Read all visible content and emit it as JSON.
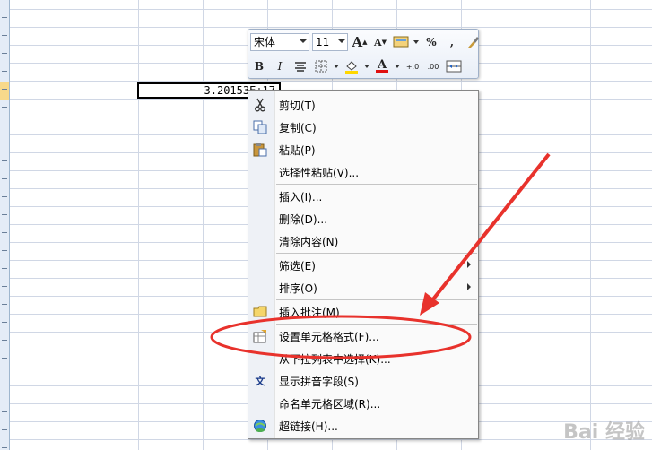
{
  "cell": {
    "value": "3.20153E+17"
  },
  "mini_toolbar": {
    "font_name": "宋体",
    "font_size": "11",
    "row1_icons": [
      "grow-font-icon",
      "shrink-font-icon",
      "format-painter-icon",
      "percent-icon",
      "comma-icon",
      "brush-icon"
    ],
    "bold": "B",
    "italic": "I",
    "percent": "%",
    "comma": ",",
    "grow": "A",
    "shrink": "A",
    "font_color_glyph": "A",
    "inc_decimal": "+.0",
    "dec_decimal": ".00"
  },
  "menu": {
    "items": [
      {
        "label": "剪切(T)",
        "icon": "scissors-icon"
      },
      {
        "label": "复制(C)",
        "icon": "copy-icon"
      },
      {
        "label": "粘贴(P)",
        "icon": "paste-icon"
      },
      {
        "label": "选择性粘贴(V)..."
      },
      {
        "label": "插入(I)..."
      },
      {
        "label": "删除(D)..."
      },
      {
        "label": "清除内容(N)"
      },
      {
        "label": "筛选(E)",
        "submenu": true
      },
      {
        "label": "排序(O)",
        "submenu": true
      },
      {
        "label": "插入批注(M)",
        "icon": "comment-icon"
      },
      {
        "label": "设置单元格格式(F)...",
        "icon": "format-cells-icon"
      },
      {
        "label": "从下拉列表中选择(K)..."
      },
      {
        "label": "显示拼音字段(S)",
        "icon": "phonetic-icon"
      },
      {
        "label": "命名单元格区域(R)..."
      },
      {
        "label": "超链接(H)...",
        "icon": "hyperlink-icon"
      }
    ]
  },
  "colors": {
    "annotation": "#e8322c",
    "grid": "#d0d7e5",
    "highlight_fill": "#ffd700",
    "font_color_bar": "#e01010"
  },
  "watermark": "Bai 经验"
}
